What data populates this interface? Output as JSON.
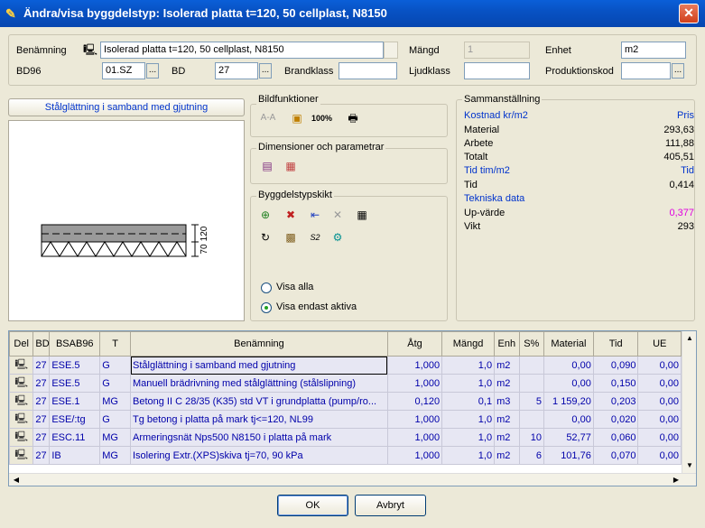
{
  "window": {
    "title": "Ändra/visa byggdelstyp: Isolerad platta t=120, 50 cellplast, N8150",
    "close_glyph": "✕"
  },
  "header": {
    "benamning_label": "Benämning",
    "benamning_value": "Isolerad platta t=120, 50 cellplast, N8150",
    "mangd_label": "Mängd",
    "mangd_value": "1",
    "enhet_label": "Enhet",
    "enhet_value": "m2",
    "bd96_label": "BD96",
    "bd96_value": "01.SZ",
    "bd_label": "BD",
    "bd_value": "27",
    "brandklass_label": "Brandklass",
    "brandklass_value": "",
    "ljudklass_label": "Ljudklass",
    "ljudklass_value": "",
    "produktionskod_label": "Produktionskod",
    "produktionskod_value": "",
    "dots": "..."
  },
  "preview": {
    "caption": "Stålglättning i samband med gjutning",
    "dim_120": "120",
    "dim_70": "70"
  },
  "bildfunktioner": {
    "label": "Bildfunktioner",
    "aa": "A-A",
    "zoom": "100%"
  },
  "dimensioner": {
    "label": "Dimensioner och parametrar"
  },
  "byggdelstypskikt": {
    "label": "Byggdelstypskikt",
    "visa_alla": "Visa alla",
    "visa_endast_aktiva": "Visa endast aktiva",
    "selected": "visa_endast_aktiva",
    "code_icon_label": "S2"
  },
  "summary": {
    "label": "Sammanställning",
    "kostnad_label": "Kostnad kr/m2",
    "kostnad_unit": "Pris",
    "material_label": "Material",
    "material_value": "293,63",
    "arbete_label": "Arbete",
    "arbete_value": "111,88",
    "totalt_label": "Totalt",
    "totalt_value": "405,51",
    "tid_header": "Tid tim/m2",
    "tid_unit": "Tid",
    "tid_label": "Tid",
    "tid_value": "0,414",
    "tekniska_label": "Tekniska data",
    "upvarde_label": "Up-värde",
    "upvarde_value": "0,377",
    "vikt_label": "Vikt",
    "vikt_value": "293"
  },
  "grid": {
    "columns": [
      "Del",
      "BD",
      "BSAB96",
      "T",
      "Benämning",
      "Åtg",
      "Mängd",
      "Enh",
      "S%",
      "Material",
      "Tid",
      "UE"
    ],
    "rows": [
      {
        "bd": "27",
        "bsab": "ESE.5",
        "t": "G",
        "name": "Stålglättning i samband med gjutning",
        "atg": "1,000",
        "mangd": "1,0",
        "enh": "m2",
        "s": "",
        "material": "0,00",
        "tid": "0,090",
        "ue": "0,00"
      },
      {
        "bd": "27",
        "bsab": "ESE.5",
        "t": "G",
        "name": "Manuell brädrivning med stålglättning (stålslipning)",
        "atg": "1,000",
        "mangd": "1,0",
        "enh": "m2",
        "s": "",
        "material": "0,00",
        "tid": "0,150",
        "ue": "0,00"
      },
      {
        "bd": "27",
        "bsab": "ESE.1",
        "t": "MG",
        "name": "Betong II C 28/35 (K35) std VT i grundplatta (pump/ro...",
        "atg": "0,120",
        "mangd": "0,1",
        "enh": "m3",
        "s": "5",
        "material": "1 159,20",
        "tid": "0,203",
        "ue": "0,00"
      },
      {
        "bd": "27",
        "bsab": "ESE/:tg",
        "t": "G",
        "name": "Tg betong i platta på mark tj<=120,  NL99",
        "atg": "1,000",
        "mangd": "1,0",
        "enh": "m2",
        "s": "",
        "material": "0,00",
        "tid": "0,020",
        "ue": "0,00"
      },
      {
        "bd": "27",
        "bsab": "ESC.11",
        "t": "MG",
        "name": "Armeringsnät Nps500 N8150 i platta på mark",
        "atg": "1,000",
        "mangd": "1,0",
        "enh": "m2",
        "s": "10",
        "material": "52,77",
        "tid": "0,060",
        "ue": "0,00"
      },
      {
        "bd": "27",
        "bsab": "IB",
        "t": "MG",
        "name": "Isolering Extr.(XPS)skiva tj=70,  90 kPa",
        "atg": "1,000",
        "mangd": "1,0",
        "enh": "m2",
        "s": "6",
        "material": "101,76",
        "tid": "0,070",
        "ue": "0,00"
      }
    ]
  },
  "buttons": {
    "ok": "OK",
    "avbryt": "Avbryt"
  },
  "colors": {
    "title_blue": "#0852c4",
    "link_blue": "#0033cc",
    "upvarde": "#e000e0",
    "row_bg": "#e7e7f3"
  }
}
